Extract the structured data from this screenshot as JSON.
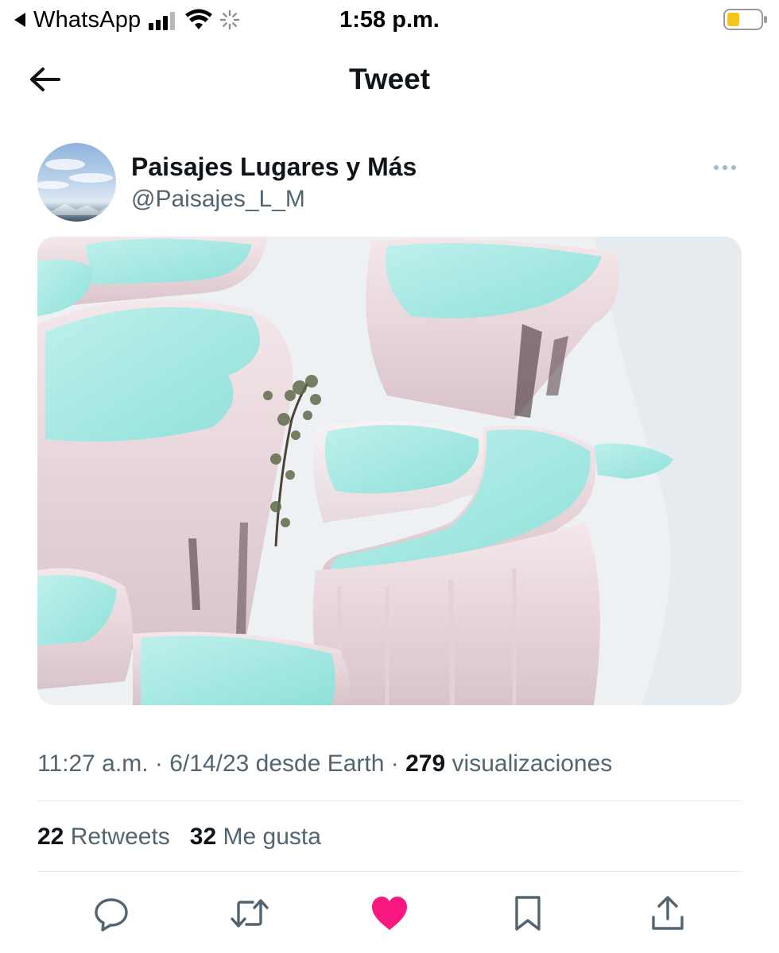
{
  "status_bar": {
    "back_app": "WhatsApp",
    "time": "1:58 p.m.",
    "icons": [
      "back-triangle-icon",
      "signal-icon",
      "wifi-icon",
      "loading-spinner-icon",
      "battery-icon"
    ]
  },
  "header": {
    "title": "Tweet",
    "back_icon": "arrow-left-icon"
  },
  "tweet": {
    "author": {
      "display_name": "Paisajes Lugares y Más",
      "handle": "@Paisajes_L_M"
    },
    "more_icon": "more-dots-icon",
    "media": {
      "description_icon": "travertine-pools-photo"
    },
    "meta": {
      "time": "11:27 a.m.",
      "sep1": "·",
      "date": "6/14/23",
      "source": "desde Earth",
      "sep2": "·",
      "views_count": "279",
      "views_label": "visualizaciones"
    },
    "stats": {
      "retweets_count": "22",
      "retweets_label": "Retweets",
      "likes_count": "32",
      "likes_label": "Me gusta"
    },
    "actions": [
      "reply-icon",
      "retweet-icon",
      "like-icon",
      "bookmark-icon",
      "share-icon"
    ],
    "colors": {
      "text": "#0f1419",
      "secondary": "#536471",
      "like_active": "#f91880",
      "battery_low": "#f5c518"
    }
  }
}
